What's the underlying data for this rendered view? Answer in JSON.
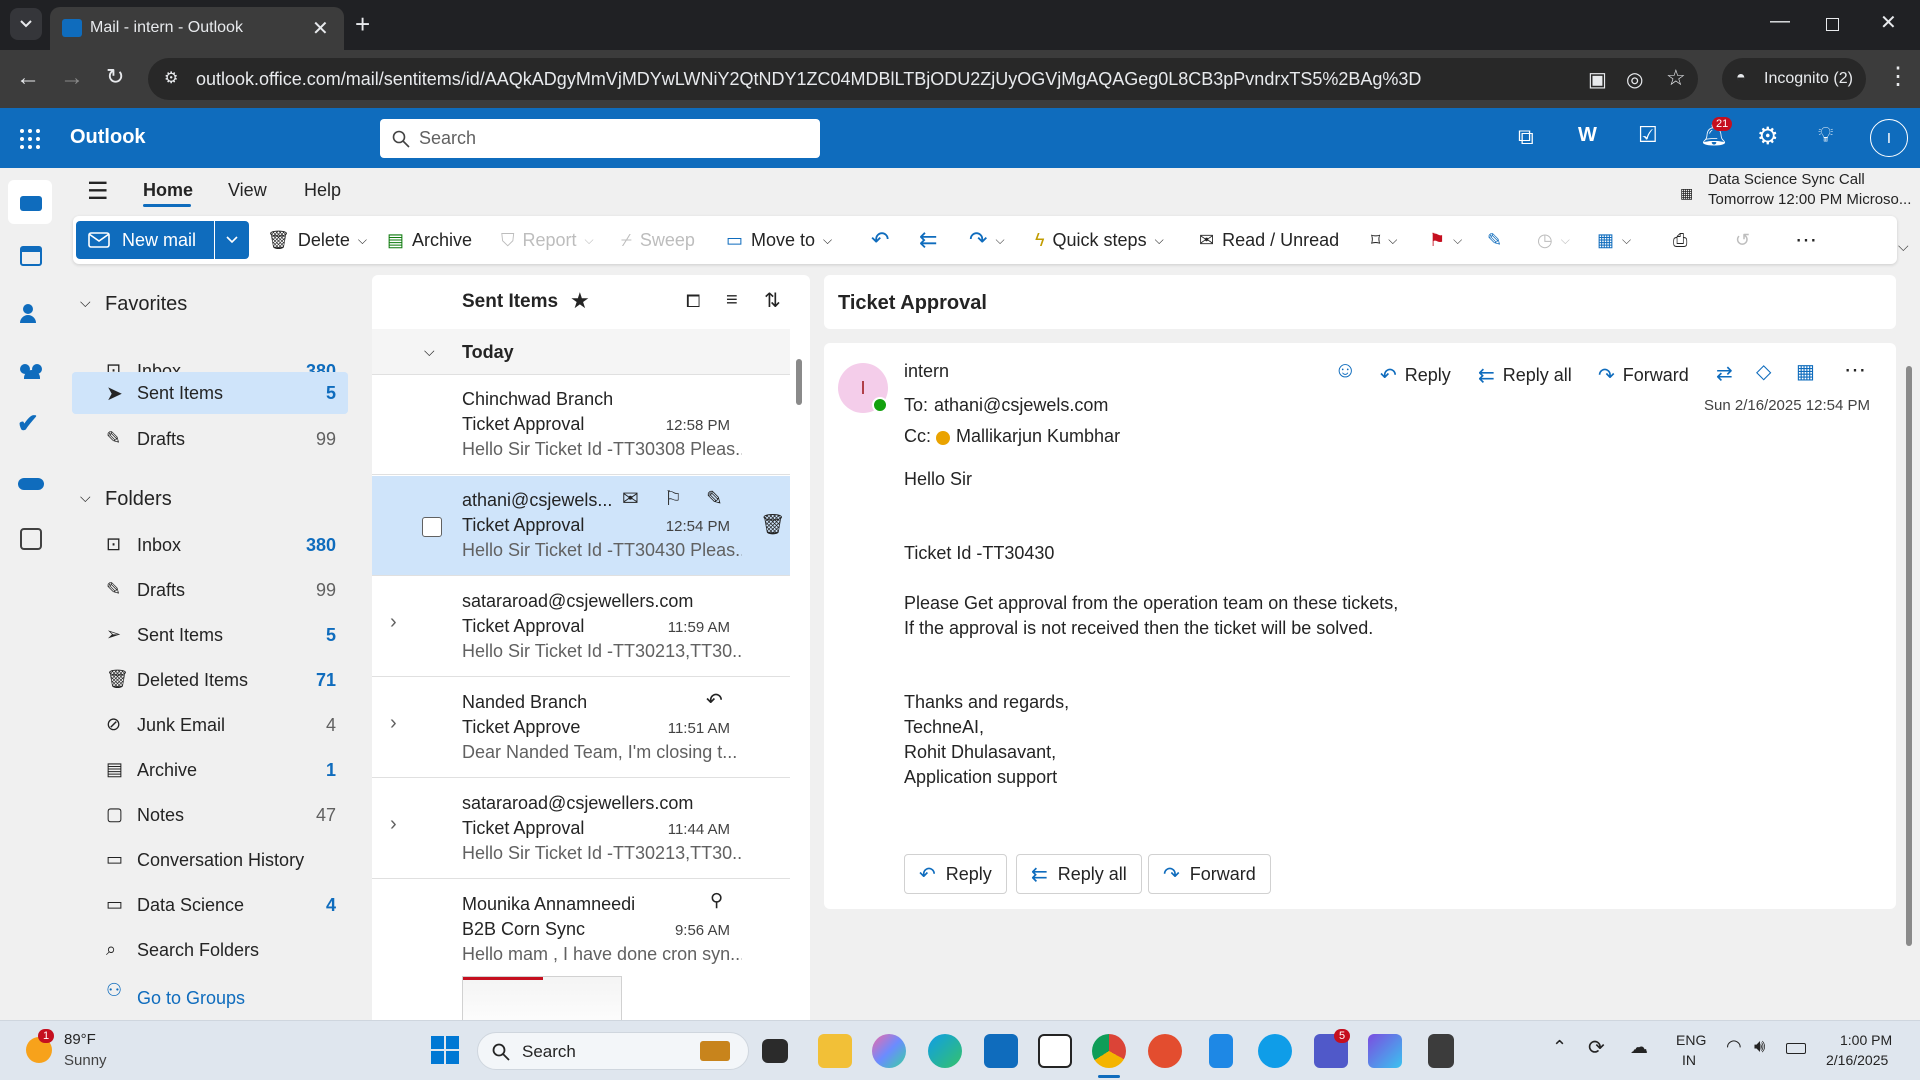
{
  "browser": {
    "tab_title": "Mail - intern - Outlook",
    "url": "outlook.office.com/mail/sentitems/id/AAQkADgyMmVjMDYwLWNiY2QtNDY1ZC04MDBlLTBjODU2ZjUyOGVjMgAQAGeg0L8CB3pPvndrxTS5%2BAg%3D",
    "incognito_label": "Incognito (2)"
  },
  "header": {
    "app_name": "Outlook",
    "search_placeholder": "Search",
    "notification_count": "21",
    "avatar_initial": "I"
  },
  "nav_tabs": [
    "Home",
    "View",
    "Help"
  ],
  "upcoming": {
    "title": "Data Science Sync Call",
    "time": "Tomorrow 12:00 PM Microso..."
  },
  "ribbon": {
    "new_mail": "New mail",
    "delete": "Delete",
    "archive": "Archive",
    "report": "Report",
    "sweep": "Sweep",
    "move_to": "Move to",
    "quick_steps": "Quick steps",
    "read_unread": "Read / Unread"
  },
  "folders": {
    "favorites_label": "Favorites",
    "folders_label": "Folders",
    "favorites": [
      {
        "name": "Inbox",
        "count": "380"
      },
      {
        "name": "Sent Items",
        "count": "5"
      },
      {
        "name": "Drafts",
        "count": "99"
      }
    ],
    "list": [
      {
        "name": "Inbox",
        "count": "380"
      },
      {
        "name": "Drafts",
        "count": "99"
      },
      {
        "name": "Sent Items",
        "count": "5"
      },
      {
        "name": "Deleted Items",
        "count": "71"
      },
      {
        "name": "Junk Email",
        "count": "4"
      },
      {
        "name": "Archive",
        "count": "1"
      },
      {
        "name": "Notes",
        "count": "47"
      },
      {
        "name": "Conversation History",
        "count": ""
      },
      {
        "name": "Data Science",
        "count": "4"
      },
      {
        "name": "Search Folders",
        "count": ""
      }
    ],
    "go_to_groups": "Go to Groups"
  },
  "message_list": {
    "title": "Sent Items",
    "group": "Today",
    "messages": [
      {
        "from": "Chinchwad Branch",
        "subject": "Ticket Approval",
        "time": "12:58 PM",
        "preview": "Hello Sir Ticket Id -TT30308 Pleas..."
      },
      {
        "from": "athani@csjewels...",
        "subject": "Ticket Approval",
        "time": "12:54 PM",
        "preview": "Hello Sir Ticket Id -TT30430 Pleas..."
      },
      {
        "from": "satararoad@csjewellers.com",
        "subject": "Ticket Approval",
        "time": "11:59 AM",
        "preview": "Hello Sir Ticket Id -TT30213,TT30..."
      },
      {
        "from": "Nanded Branch",
        "subject": "Ticket Approve",
        "time": "11:51 AM",
        "preview": "Dear Nanded Team, I'm closing t..."
      },
      {
        "from": "satararoad@csjewellers.com",
        "subject": "Ticket Approval",
        "time": "11:44 AM",
        "preview": "Hello Sir Ticket Id -TT30213,TT30..."
      },
      {
        "from": "Mounika Annamneedi",
        "subject": "B2B Corn Sync",
        "time": "9:56 AM",
        "preview": "Hello mam , I have done cron syn..."
      }
    ]
  },
  "reading": {
    "subject": "Ticket Approval",
    "sender": "intern",
    "sender_initial": "I",
    "to_label": "To:",
    "to": "athani@csjewels.com",
    "cc_label": "Cc:",
    "cc": "Mallikarjun Kumbhar",
    "date": "Sun 2/16/2025 12:54 PM",
    "reply": "Reply",
    "reply_all": "Reply all",
    "forward": "Forward",
    "body": [
      "Hello Sir",
      "Ticket Id -TT30430",
      "Please Get approval from the operation team on these tickets,",
      "If the approval is not received then the ticket will be solved.",
      "Thanks and regards,",
      "TechneAI,",
      "Rohit Dhulasavant,",
      "Application support"
    ]
  },
  "taskbar": {
    "weather_temp": "89°F",
    "weather_desc": "Sunny",
    "weather_badge": "1",
    "search": "Search",
    "teams_badge": "5",
    "lang1": "ENG",
    "lang2": "IN",
    "time": "1:00 PM",
    "date": "2/16/2025"
  }
}
